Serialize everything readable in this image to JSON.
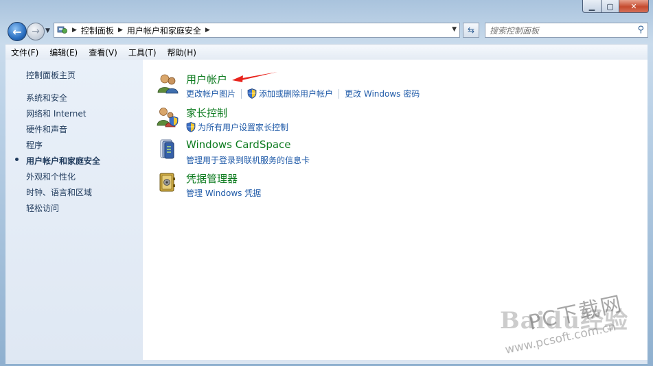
{
  "window": {
    "controls": {
      "minimize": "▁",
      "maximize": "▢",
      "close": "✕"
    }
  },
  "nav": {
    "breadcrumbs": [
      "控制面板",
      "用户帐户和家庭安全"
    ],
    "search_placeholder": "搜索控制面板"
  },
  "menu": [
    "文件(F)",
    "编辑(E)",
    "查看(V)",
    "工具(T)",
    "帮助(H)"
  ],
  "sidebar": {
    "home": "控制面板主页",
    "items": [
      "系统和安全",
      "网络和 Internet",
      "硬件和声音",
      "程序",
      "用户帐户和家庭安全",
      "外观和个性化",
      "时钟、语言和区域",
      "轻松访问"
    ],
    "active": "用户帐户和家庭安全"
  },
  "categories": [
    {
      "title": "用户帐户",
      "icon": "users-icon",
      "tasks": [
        {
          "label": "更改帐户图片",
          "shield": false
        },
        {
          "label": "添加或删除用户帐户",
          "shield": true
        },
        {
          "label": "更改 Windows 密码",
          "shield": false
        }
      ]
    },
    {
      "title": "家长控制",
      "icon": "parental-controls-icon",
      "tasks": [
        {
          "label": "为所有用户设置家长控制",
          "shield": true
        }
      ]
    },
    {
      "title": "Windows CardSpace",
      "icon": "cardspace-icon",
      "tasks": [
        {
          "label": "管理用于登录到联机服务的信息卡",
          "shield": false
        }
      ]
    },
    {
      "title": "凭据管理器",
      "icon": "credential-vault-icon",
      "tasks": [
        {
          "label": "管理 Windows 凭据",
          "shield": false
        }
      ]
    }
  ],
  "watermark": {
    "logo": "Baidu经验",
    "site_name": "PC下载网",
    "url": "www.pcsoft.com.cn"
  },
  "colors": {
    "category_title": "#0d7b1f",
    "task_link": "#1f5aa8",
    "sidebar_bg": "#e4ecf6",
    "annotation_arrow": "#e8231c"
  }
}
